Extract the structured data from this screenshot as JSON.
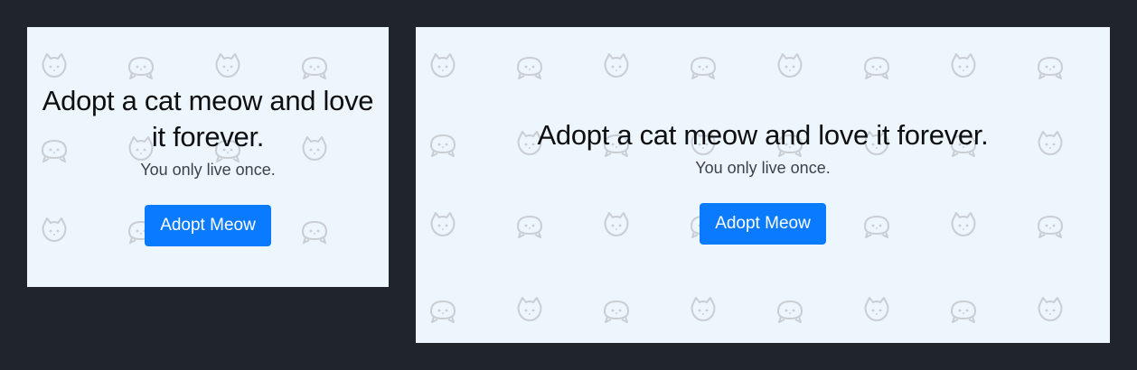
{
  "hero": {
    "headline": "Adopt a cat meow and love it forever.",
    "tagline": "You only live once.",
    "cta_label": "Adopt Meow"
  },
  "colors": {
    "page_background": "#20252c",
    "panel_background": "#edf5fd",
    "button": "#0a7bff",
    "icon": "#c9ced3"
  },
  "background_icons": [
    "cat-face-icon",
    "cat-ball-icon"
  ]
}
